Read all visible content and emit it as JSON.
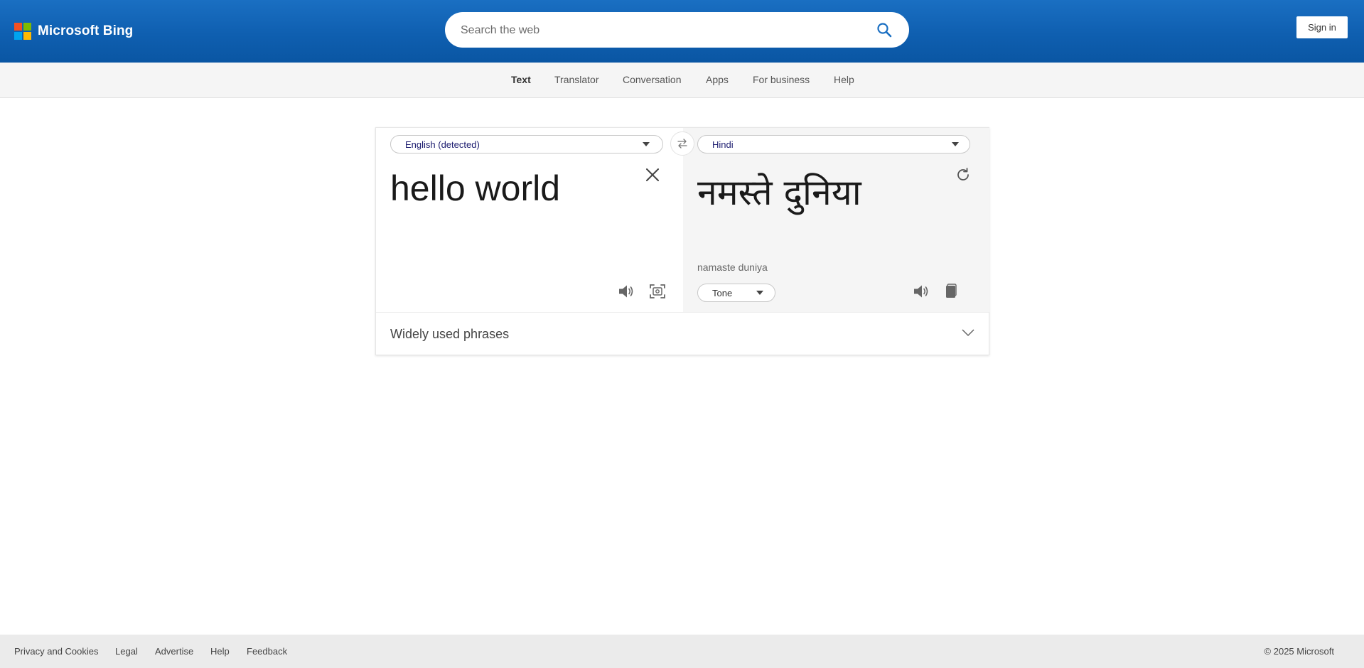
{
  "header": {
    "brand": "Microsoft Bing",
    "logo_colors": [
      "#f25022",
      "#7fba00",
      "#00a4ef",
      "#ffb900"
    ],
    "search_placeholder": "Search the web",
    "sign_in": "Sign in",
    "accent_color": "#0f5fb0"
  },
  "nav": {
    "items": [
      {
        "label": "Text",
        "active": true
      },
      {
        "label": "Translator",
        "active": false
      },
      {
        "label": "Conversation",
        "active": false
      },
      {
        "label": "Apps",
        "active": false
      },
      {
        "label": "For business",
        "active": false
      },
      {
        "label": "Help",
        "active": false
      }
    ]
  },
  "translator": {
    "source_language": "English (detected)",
    "target_language": "Hindi",
    "source_text": "hello world",
    "target_text": "नमस्ते दुनिया",
    "transliteration": "namaste duniya",
    "tone_label": "Tone",
    "icons": {
      "swap": "swap-arrows-icon",
      "clear": "close-icon",
      "speaker": "speaker-icon",
      "camera": "camera-scan-icon",
      "refresh": "refresh-icon",
      "copy": "copy-icon"
    },
    "phrases_label": "Widely used phrases"
  },
  "footer": {
    "links": [
      "Privacy and Cookies",
      "Legal",
      "Advertise",
      "Help",
      "Feedback"
    ],
    "copyright": "© 2025 Microsoft"
  }
}
